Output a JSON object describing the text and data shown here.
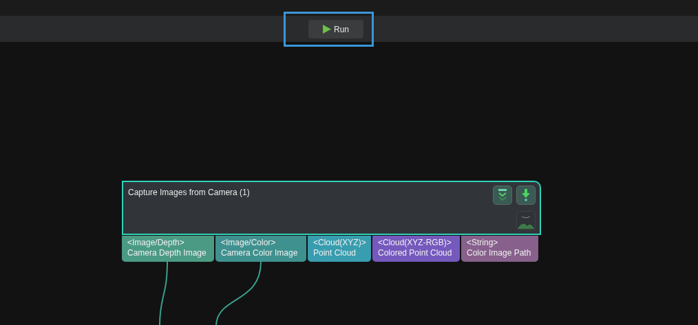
{
  "toolbar": {
    "run_button": {
      "label": "Run",
      "highlighted": true
    }
  },
  "node": {
    "title": "Capture Images from Camera (1)",
    "selected": true,
    "outputs": [
      {
        "type": "<Image/Depth>",
        "name": "Camera Depth Image",
        "color": "#4b9a84",
        "connected": true
      },
      {
        "type": "<Image/Color>",
        "name": "Camera Color Image",
        "color": "#3f918f",
        "connected": true
      },
      {
        "type": "<Cloud(XYZ)>",
        "name": "Point Cloud",
        "color": "#389dae",
        "connected": false
      },
      {
        "type": "<Cloud(XYZ-RGB)>",
        "name": "Colored Point Cloud",
        "color": "#7559bd",
        "connected": false
      },
      {
        "type": "<String>",
        "name": "Color Image Path",
        "color": "#87608c",
        "connected": false
      }
    ]
  }
}
